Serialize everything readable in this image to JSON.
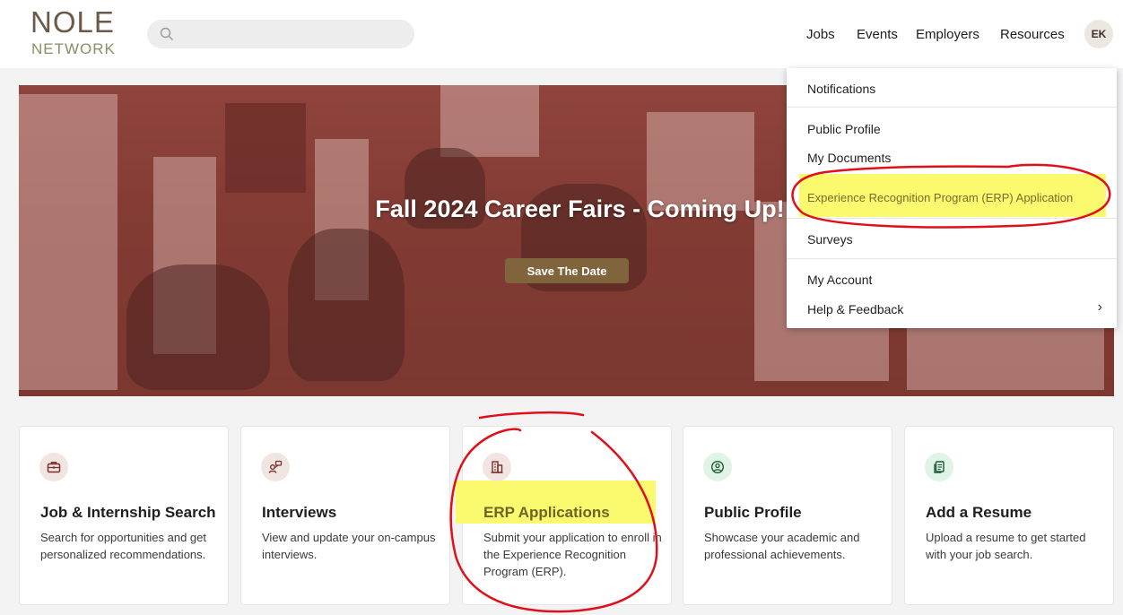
{
  "header": {
    "logo_line1": "NOLE",
    "logo_line2": "NETWORK",
    "search_placeholder": "",
    "nav": [
      "Jobs",
      "Events",
      "Employers",
      "Resources"
    ],
    "avatar_initials": "EK"
  },
  "hero": {
    "title": "Fall 2024 Career Fairs - Coming Up!",
    "button_label": "Save The Date"
  },
  "user_menu": {
    "items": {
      "notifications": "Notifications",
      "public_profile": "Public Profile",
      "my_documents": "My Documents",
      "erp_application": "Experience Recognition Program (ERP) Application",
      "surveys": "Surveys",
      "my_account": "My Account",
      "help_feedback": "Help & Feedback"
    }
  },
  "cards": [
    {
      "title": "Job & Internship Search",
      "description": "Search for opportunities and get personalized recommendations.",
      "icon": "briefcase-icon"
    },
    {
      "title": "Interviews",
      "description": "View and update your on-campus interviews.",
      "icon": "interview-icon"
    },
    {
      "title": "ERP Applications",
      "description": "Submit your application to enroll in the Experience Recognition Program (ERP).",
      "icon": "building-icon"
    },
    {
      "title": "Public Profile",
      "description": "Showcase your academic and professional achievements.",
      "icon": "profile-icon"
    },
    {
      "title": "Add a Resume",
      "description": "Upload a resume to get started with your job search.",
      "icon": "document-icon"
    }
  ],
  "colors": {
    "brand_brown": "#80643c",
    "highlight_yellow": "#fbfa6e",
    "annotation_red": "#e0101a",
    "icon_green_bg": "#dff3e7",
    "icon_brown_bg": "#f1e5e2"
  }
}
